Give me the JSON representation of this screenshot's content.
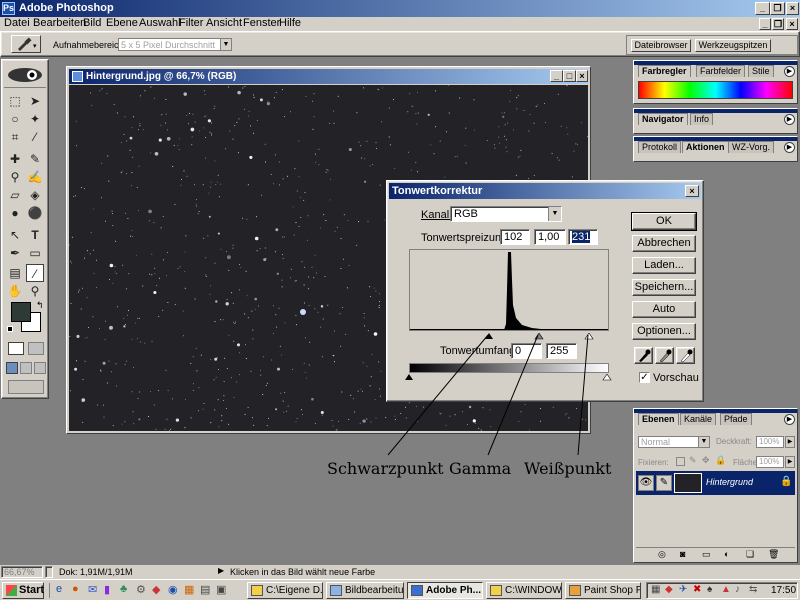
{
  "app": {
    "title": "Adobe Photoshop"
  },
  "menu": [
    "Datei",
    "Bearbeiten",
    "Bild",
    "Ebene",
    "Auswahl",
    "Filter",
    "Ansicht",
    "Fenster",
    "Hilfe"
  ],
  "options_bar": {
    "sample_label": "Aufnahmebereich:",
    "sample_value": "5 x 5 Pixel Durchschnitt",
    "palette_well": [
      "Dateibrowser",
      "Werkzeugspitzen"
    ]
  },
  "document": {
    "title": "Hintergrund.jpg @ 66,7% (RGB)"
  },
  "dialog": {
    "title": "Tonwertkorrektur",
    "channel_label": "Kanal:",
    "channel_value": "RGB",
    "input_label": "Tonwertspreizung:",
    "input_black": "102",
    "input_gamma": "1,00",
    "input_white": "231",
    "output_label": "Tonwertumfang:",
    "output_black": "0",
    "output_white": "255",
    "buttons": [
      "OK",
      "Abbrechen",
      "Laden...",
      "Speichern...",
      "Auto",
      "Optionen..."
    ],
    "preview_label": "Vorschau",
    "preview_checked": true,
    "eyedropper_icons": [
      "black-eyedropper-icon",
      "gray-eyedropper-icon",
      "white-eyedropper-icon"
    ]
  },
  "annotations": [
    "Schwarzpunkt",
    "Gamma",
    "Weißpunkt"
  ],
  "palettes": {
    "color": {
      "tabs": [
        "Farbregler",
        "Farbfelder",
        "Stile"
      ]
    },
    "navigator": {
      "tabs": [
        "Navigator",
        "Info"
      ]
    },
    "history": {
      "tabs": [
        "Protokoll",
        "Aktionen",
        "WZ-Vorg."
      ]
    },
    "layers": {
      "tabs": [
        "Ebenen",
        "Kanäle",
        "Pfade"
      ],
      "blend_mode": "Normal",
      "opacity_label": "Deckkraft:",
      "opacity_value": "100%",
      "lock_label": "Fixieren:",
      "fill_label": "Fläche",
      "fill_value": "100%",
      "layer_name": "Hintergrund"
    }
  },
  "status_bar": {
    "zoom": "66,67%",
    "doc_info": "Dok: 1,91M/1,91M",
    "hint": "Klicken in das Bild wählt neue Farbe"
  },
  "taskbar": {
    "start": "Start",
    "tasks": [
      "C:\\Eigene D...",
      "Bildbearbeitu...",
      "Adobe Ph...",
      "C:\\WINDOW...",
      "Paint Shop Pro"
    ],
    "active_task_index": 2,
    "clock": "17:50"
  },
  "colors": {
    "title_gradient_start": "#0a246a",
    "title_gradient_end": "#a6caf0",
    "chrome": "#d4d0c8",
    "workspace": "#808080",
    "starfield": "#232226"
  }
}
